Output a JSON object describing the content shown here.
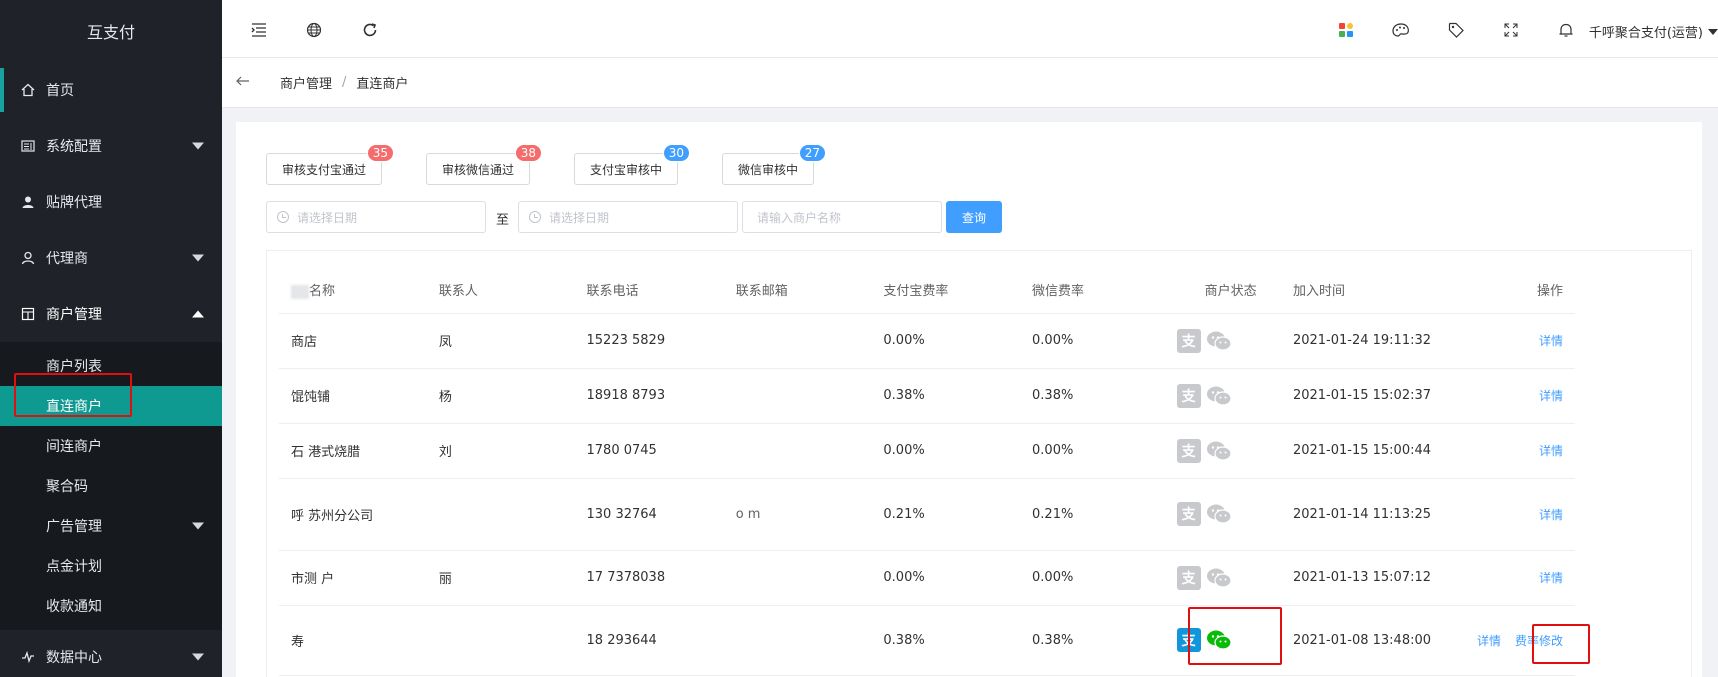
{
  "sidebar": {
    "title": "互支付",
    "items": [
      {
        "label": "首页",
        "icon": "home-icon"
      },
      {
        "label": "系统配置",
        "icon": "config-icon"
      },
      {
        "label": "贴牌代理",
        "icon": "user-solid-icon"
      },
      {
        "label": "代理商",
        "icon": "user-icon"
      },
      {
        "label": "商户管理",
        "icon": "store-icon"
      }
    ],
    "sub_items": [
      {
        "label": "商户列表"
      },
      {
        "label": "直连商户"
      },
      {
        "label": "间连商户"
      },
      {
        "label": "聚合码"
      },
      {
        "label": "广告管理"
      },
      {
        "label": "点金计划"
      },
      {
        "label": "收款通知"
      }
    ],
    "bottom_item": {
      "label": "数据中心",
      "icon": "chart-icon"
    }
  },
  "header": {
    "user": "千呼聚合支付(运营)"
  },
  "breadcrumb": {
    "parent": "商户管理",
    "separator": "/",
    "current": "直连商户"
  },
  "stats": [
    {
      "label": "审核支付宝通过",
      "count": "35",
      "color": "#f56c6c"
    },
    {
      "label": "审核微信通过",
      "count": "38",
      "color": "#f56c6c"
    },
    {
      "label": "支付宝审核中",
      "count": "30",
      "color": "#409eff"
    },
    {
      "label": "微信审核中",
      "count": "27",
      "color": "#409eff"
    }
  ],
  "filters": {
    "start_placeholder": "请选择日期",
    "to_label": "至",
    "end_placeholder": "请选择日期",
    "name_placeholder": "请输入商户名称",
    "query_label": "查询"
  },
  "table": {
    "headers": [
      "名称",
      "联系人",
      "联系电话",
      "联系邮箱",
      "支付宝费率",
      "微信费率",
      "商户状态",
      "加入时间",
      "操作"
    ],
    "detail_label": "详情",
    "fee_edit_label": "费率修改",
    "rows": [
      {
        "name": "商店",
        "contact": "凤",
        "phone": "15223 5829",
        "email": "",
        "ali_rate": "0.00%",
        "wx_rate": "0.00%",
        "time": "2021-01-24 19:11:32",
        "active": false
      },
      {
        "name": "馄饨铺",
        "contact": "杨",
        "phone": "18918 8793",
        "email": "",
        "ali_rate": "0.38%",
        "wx_rate": "0.38%",
        "time": "2021-01-15 15:02:37",
        "active": false
      },
      {
        "name": "石 港式烧腊",
        "contact": "刘",
        "phone": "1780 0745",
        "email": "",
        "ali_rate": "0.00%",
        "wx_rate": "0.00%",
        "time": "2021-01-15 15:00:44",
        "active": false
      },
      {
        "name": "呼 苏州分公司",
        "contact": "",
        "phone": "130 32764",
        "email": "o m",
        "ali_rate": "0.21%",
        "wx_rate": "0.21%",
        "time": "2021-01-14 11:13:25",
        "active": false
      },
      {
        "name": "市测 户",
        "contact": "丽",
        "phone": "17 7378038",
        "email": "",
        "ali_rate": "0.00%",
        "wx_rate": "0.00%",
        "time": "2021-01-13 15:07:12",
        "active": false
      },
      {
        "name": "寿",
        "contact": "",
        "phone": "18 293644",
        "email": "",
        "ali_rate": "0.38%",
        "wx_rate": "0.38%",
        "time": "2021-01-08 13:48:00",
        "active": true
      }
    ]
  },
  "colors": {
    "sidebar_bg": "#1f2329",
    "active_teal": "#0e9a90",
    "primary_blue": "#409eff",
    "badge_red": "#f56c6c",
    "alipay_blue": "#1296db",
    "wechat_green": "#09bb07",
    "inactive_gray": "#c8c9cc",
    "highlight_red": "#e01010"
  }
}
